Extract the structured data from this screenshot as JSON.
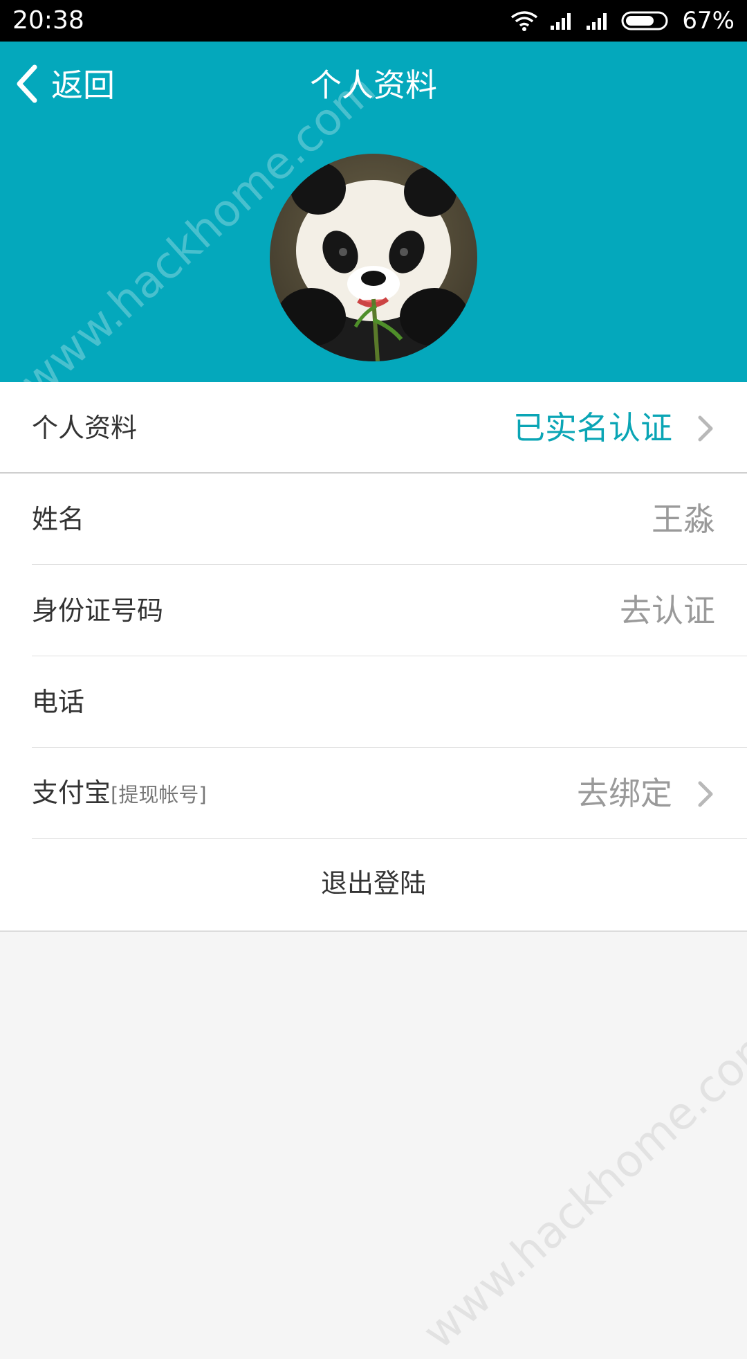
{
  "status_bar": {
    "time": "20:38",
    "battery": "67%",
    "icons": [
      "wifi-icon",
      "signal-icon",
      "signal-icon",
      "battery-icon"
    ]
  },
  "header": {
    "back_label": "返回",
    "title": "个人资料",
    "background_color": "#04a8bc"
  },
  "profile": {
    "section_label": "个人资料",
    "verification_status": "已实名认证",
    "accent_color": "#0aa5b5",
    "name_label": "姓名",
    "name_value": "王淼",
    "id_label": "身份证号码",
    "id_action": "去认证",
    "phone_label": "电话",
    "phone_value": "",
    "alipay_label": "支付宝",
    "alipay_sublabel": "[提现帐号]",
    "alipay_action": "去绑定",
    "logout_label": "退出登陆"
  },
  "watermark": {
    "text": "www.hackhome.com"
  }
}
